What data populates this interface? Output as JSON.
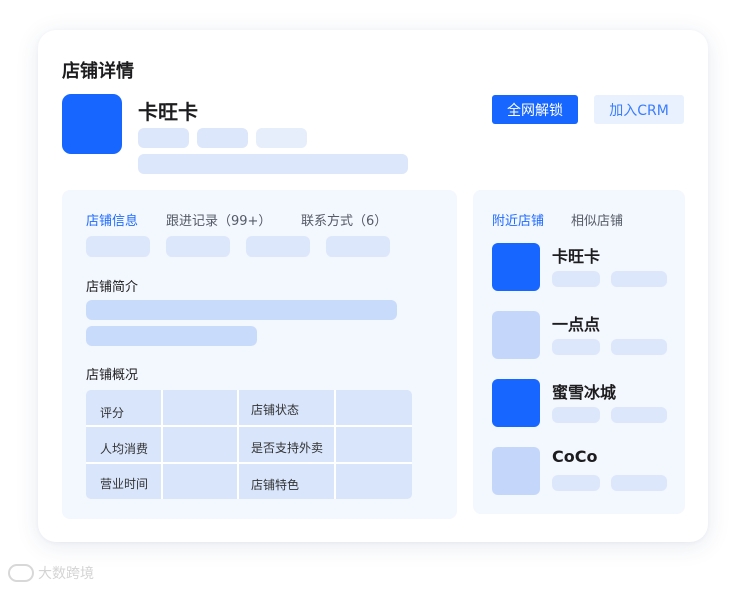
{
  "page": {
    "title": "店铺详情",
    "store_name": "卡旺卡",
    "actions": {
      "unlock_label": "全网解锁",
      "add_crm_label": "加入CRM"
    }
  },
  "left_panel": {
    "tabs": [
      {
        "label": "店铺信息",
        "active": true
      },
      {
        "label": "跟进记录（99+）",
        "active": false
      },
      {
        "label": "联系方式（6）",
        "active": false
      }
    ],
    "intro_title": "店铺简介",
    "overview_title": "店铺概况",
    "overview_table": [
      {
        "label": "评分",
        "label2": "店铺状态"
      },
      {
        "label": "人均消费",
        "label2": "是否支持外卖"
      },
      {
        "label": "营业时间",
        "label2": "店铺特色"
      }
    ]
  },
  "right_panel": {
    "tabs": [
      {
        "label": "附近店铺",
        "active": true
      },
      {
        "label": "相似店铺",
        "active": false
      }
    ],
    "stores": [
      {
        "name": "卡旺卡",
        "logo_color": "#1666ff"
      },
      {
        "name": "一点点",
        "logo_color": "#c4d7fb"
      },
      {
        "name": "蜜雪冰城",
        "logo_color": "#1666ff"
      },
      {
        "name": "CoCo",
        "logo_color": "#c4d7fb"
      }
    ]
  },
  "watermark": {
    "text": "大数跨境"
  },
  "colors": {
    "accent": "#1666ff",
    "panel_bg": "#f3f7fe",
    "placeholder": "#dce7fb"
  }
}
